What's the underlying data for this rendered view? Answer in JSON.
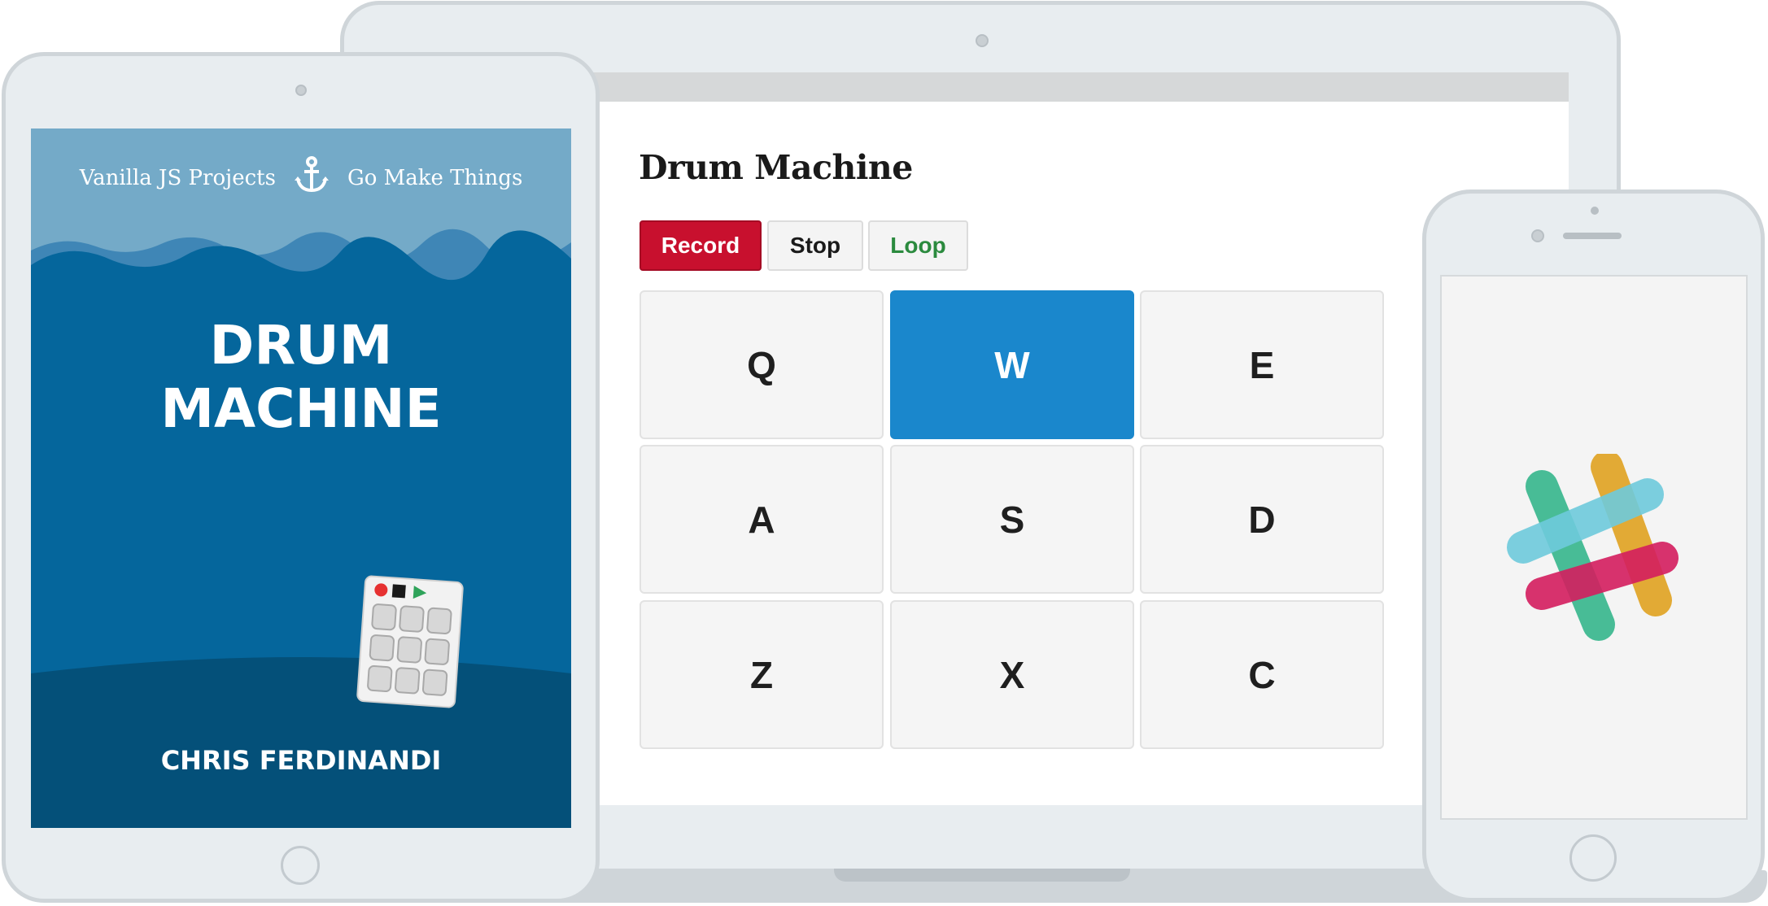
{
  "laptop_app": {
    "title": "Drum Machine",
    "controls": {
      "record_label": "Record",
      "stop_label": "Stop",
      "loop_label": "Loop"
    },
    "pads": [
      {
        "key": "Q",
        "active": false
      },
      {
        "key": "W",
        "active": true
      },
      {
        "key": "E",
        "active": false
      },
      {
        "key": "A",
        "active": false
      },
      {
        "key": "S",
        "active": false
      },
      {
        "key": "D",
        "active": false
      },
      {
        "key": "Z",
        "active": false
      },
      {
        "key": "X",
        "active": false
      },
      {
        "key": "C",
        "active": false
      }
    ]
  },
  "tablet_cover": {
    "series": "Vanilla JS Projects",
    "publisher": "Go Make Things",
    "title_line1": "DRUM",
    "title_line2": "MACHINE",
    "author": "CHRIS FERDINANDI",
    "header_icon": "anchor-icon"
  },
  "phone": {
    "icon": "slack-logo-icon"
  },
  "colors": {
    "record": "#c8102e",
    "loop_text": "#2b8a3e",
    "active_pad": "#1a87cc",
    "cover_blue": "#05669c",
    "cover_sky": "#74aac8"
  }
}
